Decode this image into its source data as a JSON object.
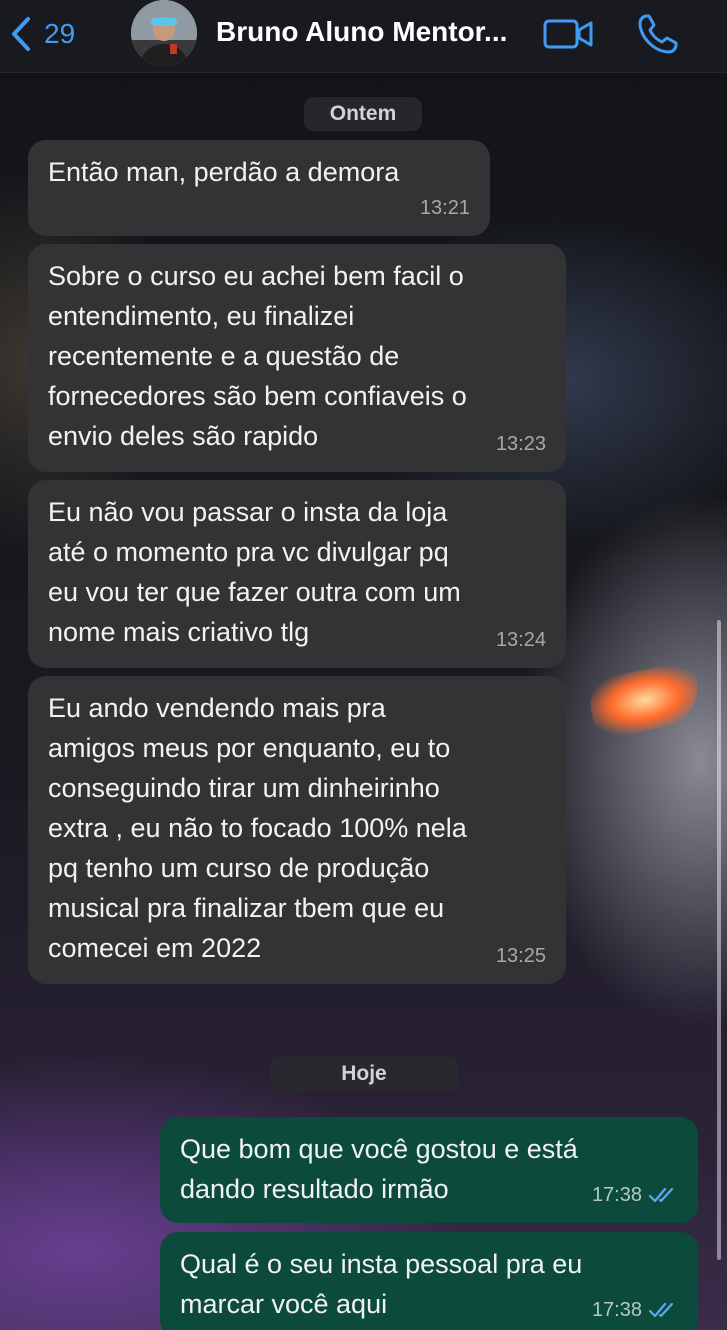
{
  "header": {
    "back_count": "29",
    "contact_name": "Bruno Aluno Mentor...",
    "colors": {
      "accent": "#3f9cf5"
    }
  },
  "date_chips": {
    "yesterday": "Ontem",
    "today": "Hoje"
  },
  "messages": [
    {
      "direction": "incoming",
      "text": "Então man, perdão a demora",
      "time": "13:21"
    },
    {
      "direction": "incoming",
      "text": "Sobre o curso eu achei bem facil o\nentendimento, eu finalizei\nrecentemente e a questão de\nfornecedores são bem confiaveis o\nenvio deles são rapido",
      "time": "13:23"
    },
    {
      "direction": "incoming",
      "text": "Eu não vou passar o insta da loja\naté o momento pra vc divulgar pq\neu vou ter que fazer outra com um\nnome mais criativo tlg",
      "time": "13:24"
    },
    {
      "direction": "incoming",
      "text": "Eu ando vendendo mais pra\namigos meus por enquanto, eu to\nconseguindo tirar um dinheirinho\nextra , eu não to focado 100% nela\npq tenho um curso de produção\nmusical pra finalizar tbem que eu\ncomecei em 2022",
      "time": "13:25"
    },
    {
      "direction": "outgoing",
      "text": "Que bom que você gostou e está\ndando resultado irmão",
      "time": "17:38",
      "status": "read"
    },
    {
      "direction": "outgoing",
      "text": "Qual é o seu insta pessoal pra eu\nmarcar você aqui",
      "time": "17:38",
      "status": "read"
    }
  ],
  "theme": {
    "incoming_bubble": "#333335",
    "outgoing_bubble": "#0c4b3c",
    "read_tick": "#5aa8f0"
  }
}
